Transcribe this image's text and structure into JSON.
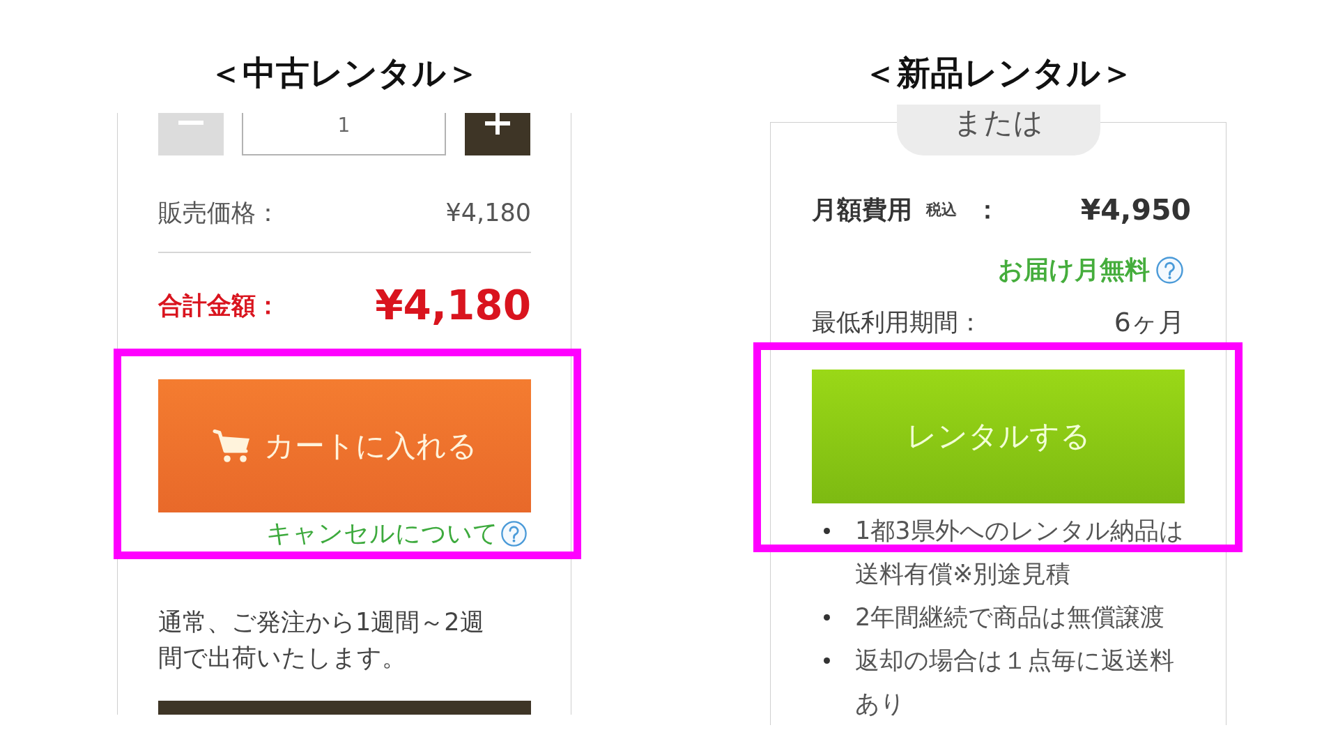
{
  "panels": [
    {
      "kind": "used",
      "heading": "＜中古レンタル＞",
      "quantity": {
        "value": "1",
        "decrement": {
          "disabled": true
        },
        "increment": {
          "disabled": false
        }
      },
      "price": {
        "label": "販売価格：",
        "value": "¥4,180"
      },
      "total": {
        "label": "合計金額：",
        "value": "¥4,180"
      },
      "action": {
        "highlighted": true,
        "button": "カートに入れる",
        "link": "キャンセルについて"
      },
      "note": "通常、ご発注から1週間～2週間で出荷いたします。"
    },
    {
      "kind": "new",
      "heading": "＜新品レンタル＞",
      "separator": "または",
      "monthly_fee": {
        "label": "月額費用",
        "tax_note": "税込",
        "colon": "：",
        "value": "¥4,950"
      },
      "free_note": "お届け月無料",
      "minimum_period": {
        "label": "最低利用期間：",
        "value": "6ヶ月"
      },
      "action": {
        "highlighted": true,
        "button": "レンタルする"
      },
      "bullets": [
        "1都3県外へのレンタル納品は送料有償※別途見積",
        "2年間継続で商品は無償譲渡",
        "返却の場合は１点毎に返送料あり"
      ]
    }
  ]
}
